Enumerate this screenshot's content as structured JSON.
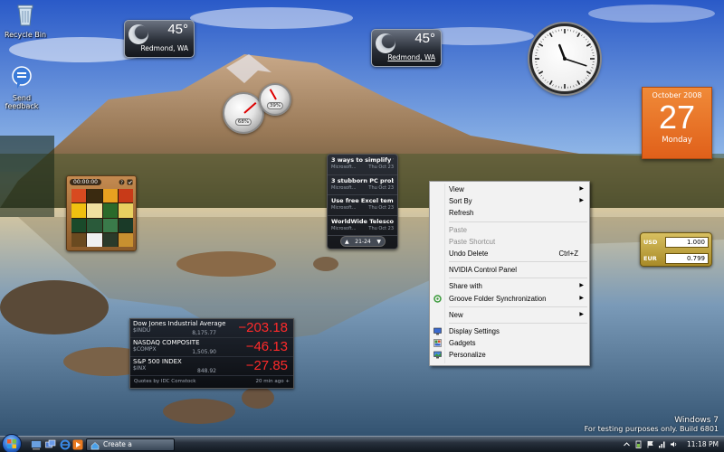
{
  "desktop": {
    "icons": [
      {
        "label": "Recycle Bin",
        "icon": "recycle-bin-icon"
      },
      {
        "label": "Send feedback",
        "icon": "feedback-icon"
      }
    ]
  },
  "weather": [
    {
      "temp": "45°",
      "city": "Redmond, WA"
    },
    {
      "temp": "45°",
      "city": "Redmond, WA"
    }
  ],
  "meters": {
    "cpu_percent": "68%",
    "memory_percent": "39%",
    "cpu_level": 0.68,
    "memory_level": 0.39
  },
  "clock": {
    "hour": 11,
    "minute": 18
  },
  "calendar": {
    "month": "October 2008",
    "day": "27",
    "weekday": "Monday"
  },
  "feed": {
    "items": [
      {
        "title": "3 ways to simplify y...",
        "source": "Microsoft...",
        "date": "Thu Oct 23"
      },
      {
        "title": "3 stubborn PC proble...",
        "source": "Microsoft...",
        "date": "Thu Oct 23"
      },
      {
        "title": "Use free Excel temp...",
        "source": "Microsoft...",
        "date": "Thu Oct 23"
      },
      {
        "title": "WorldWide Telescope",
        "source": "Microsoft...",
        "date": "Thu Oct 23"
      }
    ],
    "range": "21-24",
    "prev": "▲",
    "next": "▼"
  },
  "puzzle": {
    "timer": "00:00:00"
  },
  "currency": {
    "rows": [
      {
        "code": "USD",
        "value": "1.000"
      },
      {
        "code": "EUR",
        "value": "0.799"
      }
    ]
  },
  "stocks": {
    "rows": [
      {
        "name": "Dow Jones Industrial Average",
        "symbol": "$INDU",
        "price": "8,175.77",
        "change": "−203.18"
      },
      {
        "name": "NASDAQ COMPOSITE",
        "symbol": "$COMPX",
        "price": "1,505.90",
        "change": "−46.13"
      },
      {
        "name": "S&P 500 INDEX",
        "symbol": "$INX",
        "price": "848.92",
        "change": "−27.85"
      }
    ],
    "footer_source": "Quotes by IDC Comstock",
    "footer_time": "20 min ago",
    "add": "+"
  },
  "context_menu": {
    "view": "View",
    "sort_by": "Sort By",
    "refresh": "Refresh",
    "paste": "Paste",
    "paste_shortcut": "Paste Shortcut",
    "undo_delete": "Undo Delete",
    "undo_shortcut": "Ctrl+Z",
    "nvidia": "NVIDIA Control Panel",
    "share_with": "Share with",
    "groove": "Groove Folder Synchronization",
    "new": "New",
    "display_settings": "Display Settings",
    "gadgets": "Gadgets",
    "personalize": "Personalize",
    "arrow": "▶"
  },
  "watermark": {
    "line1": "Windows 7",
    "line2": "For testing purposes only. Build 6801"
  },
  "taskbar": {
    "task_label": "Create a HomeGroup",
    "time": "11:18 PM"
  }
}
